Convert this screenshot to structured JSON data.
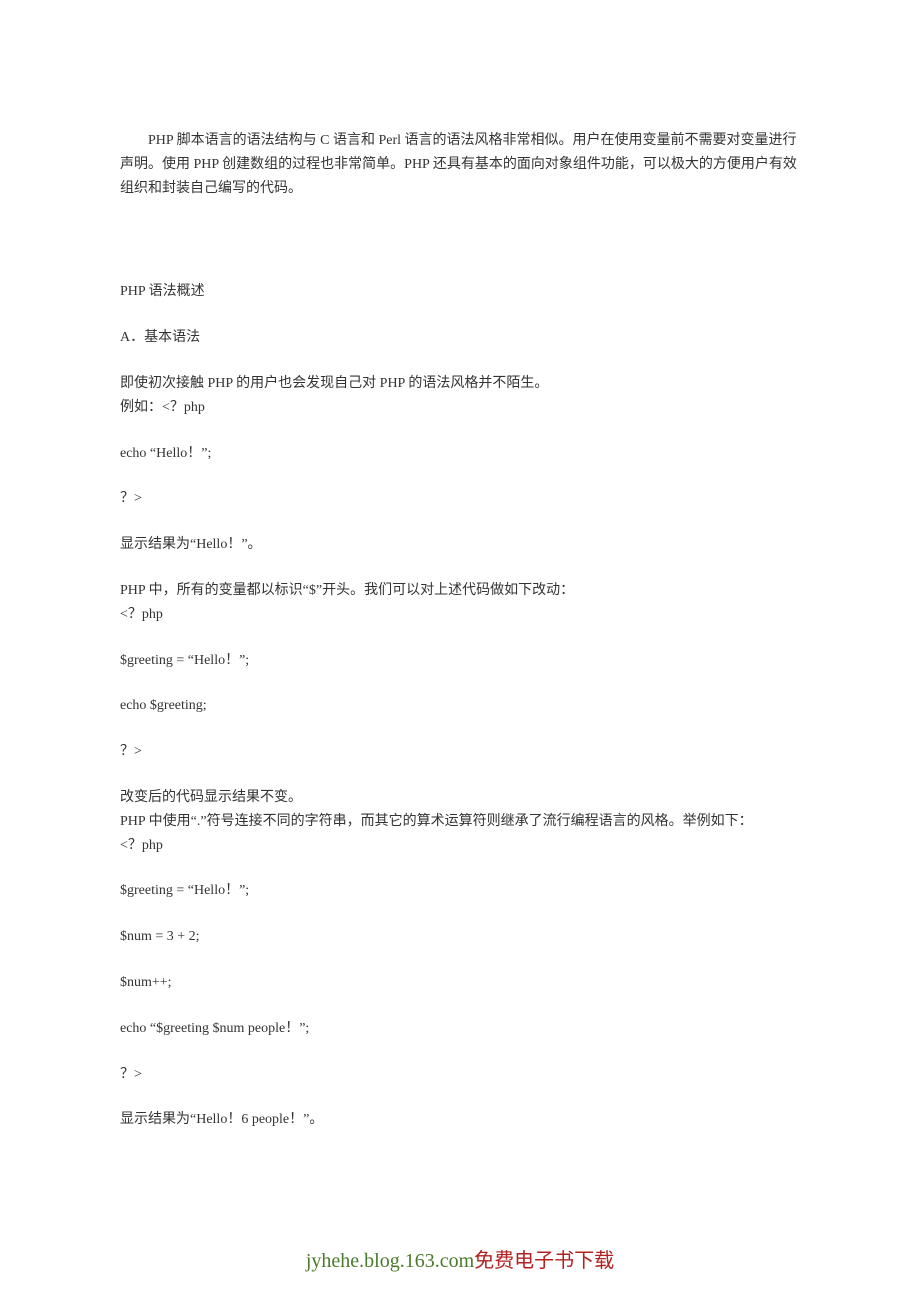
{
  "intro": "PHP 脚本语言的语法结构与 C 语言和 Perl 语言的语法风格非常相似。用户在使用变量前不需要对变量进行声明。使用 PHP 创建数组的过程也非常简单。PHP 还具有基本的面向对象组件功能，可以极大的方便用户有效组织和封装自己编写的代码。",
  "section_title": "PHP 语法概述",
  "subsection_a": "A．基本语法",
  "p1": "即使初次接触 PHP 的用户也会发现自己对 PHP 的语法风格并不陌生。",
  "p2": "例如：<？php",
  "p3": "echo  “Hello！”;",
  "p4": "？>",
  "p5": "显示结果为“Hello！”。",
  "p6": "PHP 中，所有的变量都以标识“$”开头。我们可以对上述代码做如下改动：",
  "p7": "<？php",
  "p8": "$greeting =  “Hello！”;",
  "p9": "echo $greeting;",
  "p10": "？>",
  "p11": "改变后的代码显示结果不变。",
  "p12": "PHP 中使用“.”符号连接不同的字符串，而其它的算术运算符则继承了流行编程语言的风格。举例如下：",
  "p13": "<？php",
  "p14": "$greeting =  “Hello！”;",
  "p15": "$num = 3 + 2;",
  "p16": "$num++;",
  "p17": "echo  “$greeting $num people！”;",
  "p18": "？>",
  "p19": "显示结果为“Hello！6 people！”。",
  "footer_link": "jyhehe.blog.163.com",
  "footer_text": "免费电子书下载"
}
